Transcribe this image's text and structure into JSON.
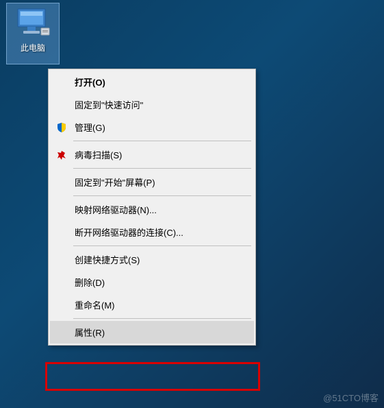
{
  "desktop": {
    "icon_label": "此电脑"
  },
  "menu": {
    "open": "打开(O)",
    "pin_quick_access": "固定到\"快速访问\"",
    "manage": "管理(G)",
    "virus_scan": "病毒扫描(S)",
    "pin_start": "固定到\"开始\"屏幕(P)",
    "map_network_drive": "映射网络驱动器(N)...",
    "disconnect_network_drive": "断开网络驱动器的连接(C)...",
    "create_shortcut": "创建快捷方式(S)",
    "delete": "删除(D)",
    "rename": "重命名(M)",
    "properties": "属性(R)"
  },
  "watermark": "@51CTO博客"
}
